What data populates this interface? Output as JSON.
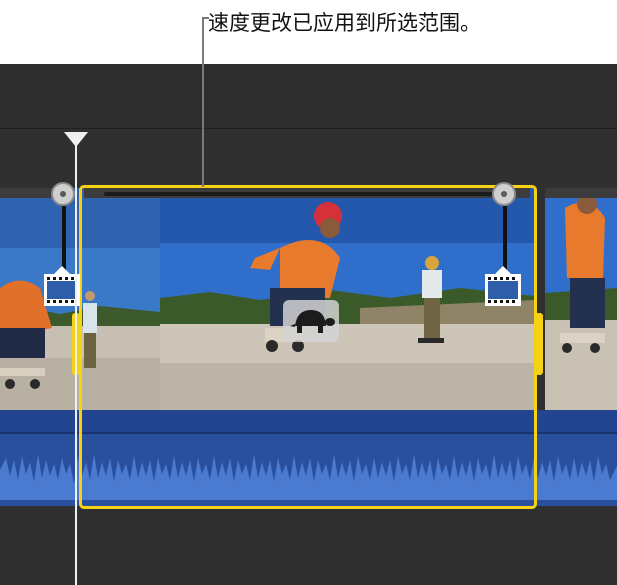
{
  "callout": {
    "text": "速度更改已应用到所选范围。"
  },
  "timeline": {
    "selected_range_color": "#f5d214",
    "audio_color": "#2a4f9c",
    "speed_indicator": "turtle-icon",
    "speed_setting": "slow"
  }
}
